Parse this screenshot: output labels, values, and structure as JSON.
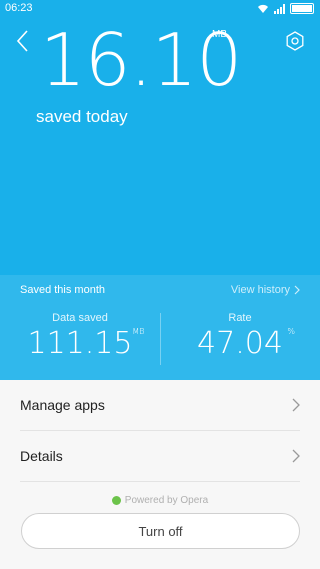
{
  "status_bar": {
    "time": "06:23"
  },
  "hero": {
    "saved_value": "16.10",
    "saved_unit": "MB",
    "saved_caption": "saved today"
  },
  "month": {
    "label": "Saved this month",
    "view_history": "View history",
    "data_saved_label": "Data saved",
    "data_saved_value": "111.15",
    "data_saved_unit": "MB",
    "rate_label": "Rate",
    "rate_value": "47.04",
    "rate_unit": "%"
  },
  "list": {
    "items": [
      {
        "label": "Manage apps"
      },
      {
        "label": "Details"
      }
    ]
  },
  "footer": {
    "powered_by": "Powered by Opera",
    "turn_off": "Turn off"
  },
  "icons": {
    "back": "chevron-left-icon",
    "settings": "gear-icon",
    "chevron": "chevron-right-icon",
    "wifi": "wifi-icon",
    "signal": "signal-icon",
    "battery": "battery-icon",
    "opera": "opera-logo-icon"
  },
  "colors": {
    "hero_bg": "#19b0ea",
    "month_panel_bg": "#30b8ec",
    "opera_green": "#6cc34a"
  }
}
